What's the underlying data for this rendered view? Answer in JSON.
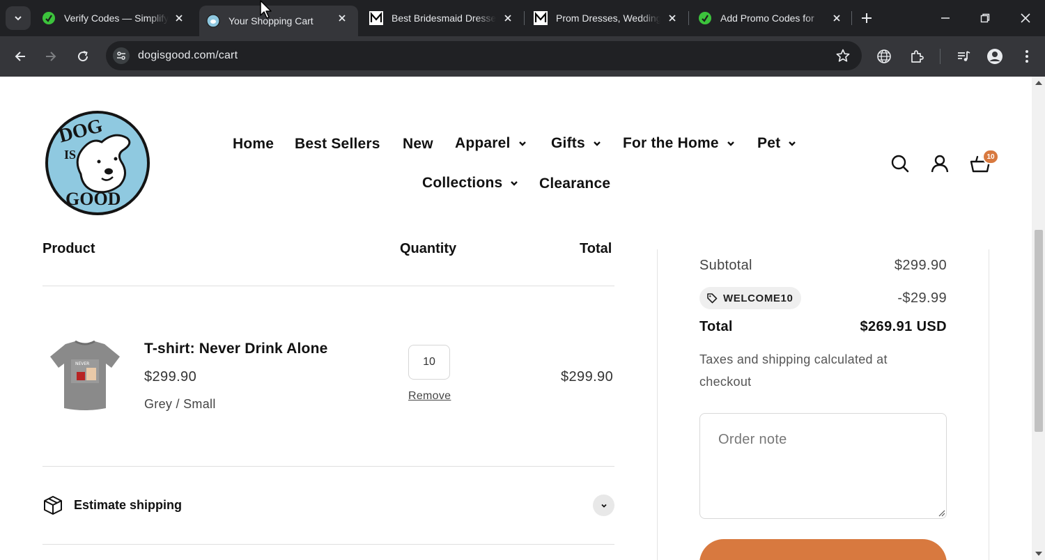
{
  "browser": {
    "tabs": [
      {
        "title": "Verify Codes — Simplify",
        "icon": "simplify-logo-icon",
        "active": false
      },
      {
        "title": "Your Shopping Cart",
        "icon": "dog-is-good-favicon",
        "active": true
      },
      {
        "title": "Best Bridesmaid Dresses",
        "icon": "m-logo-icon",
        "active": false
      },
      {
        "title": "Prom Dresses, Wedding",
        "icon": "m-logo-icon",
        "active": false
      },
      {
        "title": "Add Promo Codes for",
        "icon": "simplify-logo-icon",
        "active": false
      }
    ],
    "url": "dogisgood.com/cart"
  },
  "header": {
    "nav": [
      {
        "label": "Home",
        "dropdown": false
      },
      {
        "label": "Best Sellers",
        "dropdown": false
      },
      {
        "label": "New",
        "dropdown": false
      },
      {
        "label": "Apparel",
        "dropdown": true
      },
      {
        "label": "Gifts",
        "dropdown": true
      },
      {
        "label": "For the Home",
        "dropdown": true
      },
      {
        "label": "Pet",
        "dropdown": true
      },
      {
        "label": "Collections",
        "dropdown": true
      },
      {
        "label": "Clearance",
        "dropdown": false
      }
    ],
    "cart_count": "10"
  },
  "cart": {
    "columns": {
      "product": "Product",
      "quantity": "Quantity",
      "total": "Total"
    },
    "items": [
      {
        "name": "T-shirt: Never Drink Alone",
        "price": "$299.90",
        "variant": "Grey / Small",
        "quantity": "10",
        "remove_label": "Remove",
        "line_total": "$299.90"
      }
    ],
    "estimate_shipping_label": "Estimate shipping"
  },
  "summary": {
    "subtotal_label": "Subtotal",
    "subtotal_value": "$299.90",
    "discount_code": "WELCOME10",
    "discount_value": "-$29.99",
    "total_label": "Total",
    "total_value": "$269.91 USD",
    "tax_note": "Taxes and shipping calculated at checkout",
    "order_note_placeholder": "Order note"
  },
  "colors": {
    "accent": "#d8793f",
    "chrome_dark": "#202124",
    "chrome_mid": "#35363a"
  }
}
